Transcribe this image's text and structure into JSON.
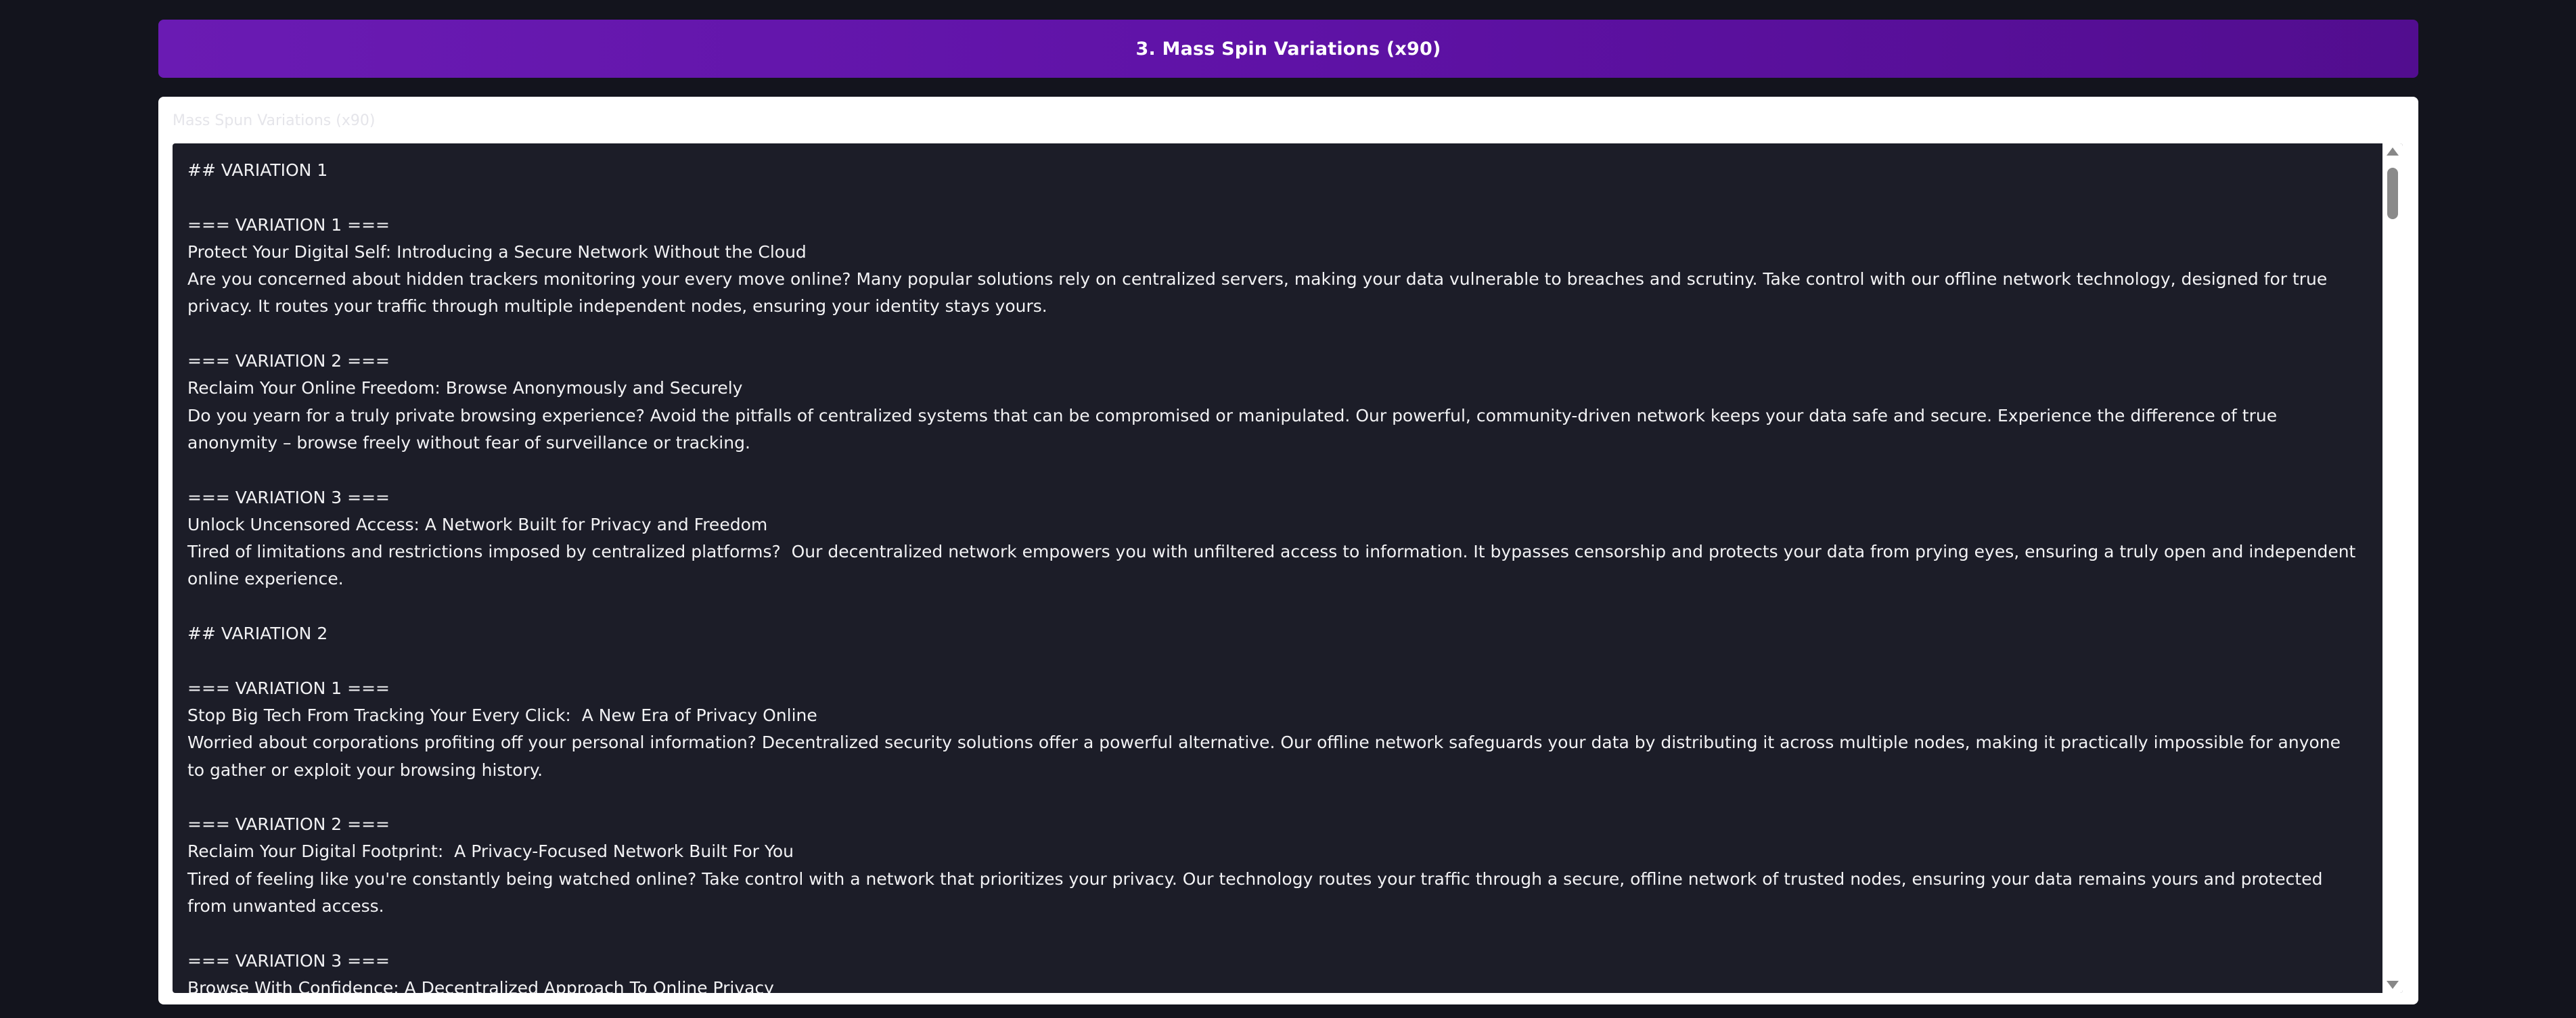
{
  "header": {
    "title": "3. Mass Spin Variations (x90)"
  },
  "panel": {
    "label": "Mass Spun Variations (x90)",
    "content": "## VARIATION 1\n\n=== VARIATION 1 ===\nProtect Your Digital Self: Introducing a Secure Network Without the Cloud\nAre you concerned about hidden trackers monitoring your every move online? Many popular solutions rely on centralized servers, making your data vulnerable to breaches and scrutiny. Take control with our offline network technology, designed for true privacy. It routes your traffic through multiple independent nodes, ensuring your identity stays yours.\n\n=== VARIATION 2 ===\nReclaim Your Online Freedom: Browse Anonymously and Securely\nDo you yearn for a truly private browsing experience? Avoid the pitfalls of centralized systems that can be compromised or manipulated. Our powerful, community-driven network keeps your data safe and secure. Experience the difference of true anonymity – browse freely without fear of surveillance or tracking.\n\n=== VARIATION 3 ===\nUnlock Uncensored Access: A Network Built for Privacy and Freedom\nTired of limitations and restrictions imposed by centralized platforms?  Our decentralized network empowers you with unfiltered access to information. It bypasses censorship and protects your data from prying eyes, ensuring a truly open and independent online experience.\n\n## VARIATION 2\n\n=== VARIATION 1 ===\nStop Big Tech From Tracking Your Every Click:  A New Era of Privacy Online\nWorried about corporations profiting off your personal information? Decentralized security solutions offer a powerful alternative. Our offline network safeguards your data by distributing it across multiple nodes, making it practically impossible for anyone to gather or exploit your browsing history.\n\n=== VARIATION 2 ===\nReclaim Your Digital Footprint:  A Privacy-Focused Network Built For You\nTired of feeling like you're constantly being watched online? Take control with a network that prioritizes your privacy. Our technology routes your traffic through a secure, offline network of trusted nodes, ensuring your data remains yours and protected from unwanted access.\n\n=== VARIATION 3 ===\nBrowse With Confidence: A Decentralized Approach To Online Privacy"
  },
  "scrollbar": {
    "up_icon": "triangle-up-icon",
    "down_icon": "triangle-down-icon"
  },
  "colors": {
    "header_start": "#6a1bb3",
    "header_end": "#520d8f",
    "background": "#13141d",
    "textarea_bg": "#1c1d28"
  }
}
